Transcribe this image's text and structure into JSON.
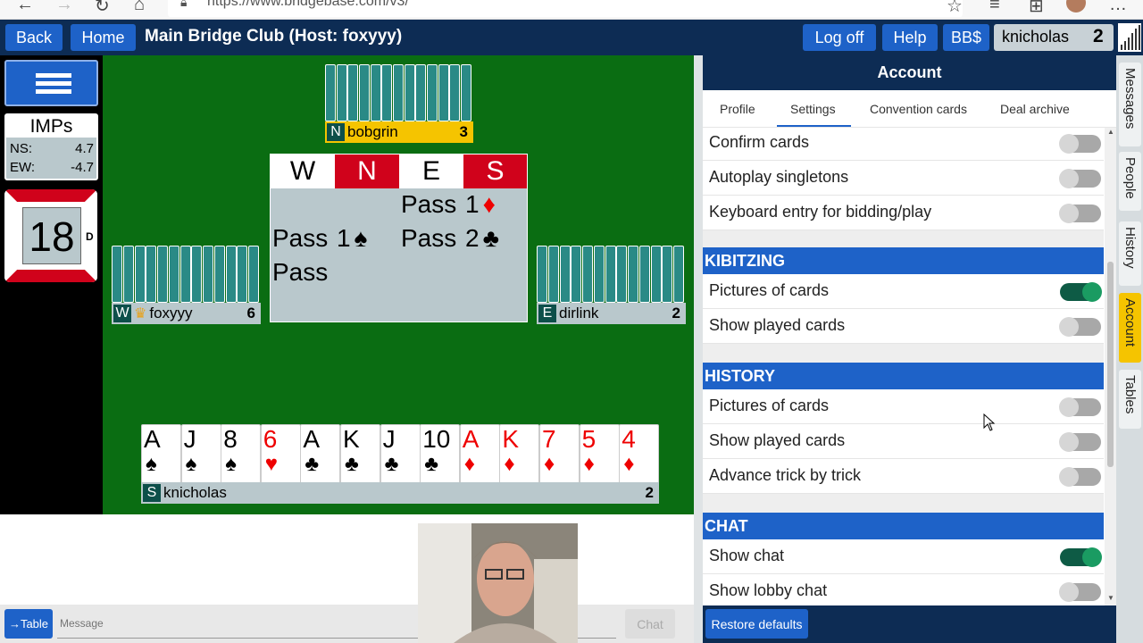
{
  "browser": {
    "url": "https://www.bridgebase.com/v3/"
  },
  "topbar": {
    "back": "Back",
    "home": "Home",
    "title": "Main Bridge Club (Host: foxyyy)",
    "logoff": "Log off",
    "help": "Help",
    "bbdollar": "BB$",
    "username": "knicholas",
    "count": "2"
  },
  "scoreboard": {
    "header": "IMPs",
    "ns_label": "NS:",
    "ns_value": "4.7",
    "ew_label": "EW:",
    "ew_value": "-4.7"
  },
  "board": {
    "number": "18",
    "dealer": "D"
  },
  "players": {
    "north": {
      "seat": "N",
      "name": "bobgrin",
      "count": "3"
    },
    "west": {
      "seat": "W",
      "name": "foxyyy",
      "count": "6"
    },
    "east": {
      "seat": "E",
      "name": "dirlink",
      "count": "2"
    },
    "south": {
      "seat": "S",
      "name": "knicholas",
      "count": "2"
    }
  },
  "auction": {
    "headers": [
      "W",
      "N",
      "E",
      "S"
    ],
    "bids": [
      {
        "text": "Pass",
        "col": 2,
        "row": 0,
        "suit": ""
      },
      {
        "text": "1",
        "col": 3,
        "row": 0,
        "suit": "♦"
      },
      {
        "text": "Pass",
        "col": 0,
        "row": 1,
        "suit": ""
      },
      {
        "text": "1",
        "col": 1,
        "row": 1,
        "suit": "♠"
      },
      {
        "text": "Pass",
        "col": 2,
        "row": 1,
        "suit": ""
      },
      {
        "text": "2",
        "col": 3,
        "row": 1,
        "suit": "♣"
      },
      {
        "text": "Pass",
        "col": 0,
        "row": 2,
        "suit": ""
      }
    ]
  },
  "hand": [
    {
      "rank": "A",
      "suit": "♠",
      "color": "black"
    },
    {
      "rank": "J",
      "suit": "♠",
      "color": "black"
    },
    {
      "rank": "8",
      "suit": "♠",
      "color": "black"
    },
    {
      "rank": "6",
      "suit": "♥",
      "color": "red"
    },
    {
      "rank": "A",
      "suit": "♣",
      "color": "black"
    },
    {
      "rank": "K",
      "suit": "♣",
      "color": "black"
    },
    {
      "rank": "J",
      "suit": "♣",
      "color": "black"
    },
    {
      "rank": "10",
      "suit": "♣",
      "color": "black"
    },
    {
      "rank": "A",
      "suit": "♦",
      "color": "red"
    },
    {
      "rank": "K",
      "suit": "♦",
      "color": "red"
    },
    {
      "rank": "7",
      "suit": "♦",
      "color": "red"
    },
    {
      "rank": "5",
      "suit": "♦",
      "color": "red"
    },
    {
      "rank": "4",
      "suit": "♦",
      "color": "red"
    }
  ],
  "chat": {
    "to_table": "→Table",
    "placeholder": "Message",
    "send": "Chat"
  },
  "account": {
    "title": "Account",
    "tabs": [
      "Profile",
      "Settings",
      "Convention cards",
      "Deal archive"
    ],
    "settings_rows": [
      "Confirm cards",
      "Autoplay singletons",
      "Keyboard entry for bidding/play"
    ],
    "kibitzing": {
      "header": "KIBITZING",
      "rows": [
        "Pictures of cards",
        "Show played cards"
      ]
    },
    "history": {
      "header": "HISTORY",
      "rows": [
        "Pictures of cards",
        "Show played cards",
        "Advance trick by trick"
      ]
    },
    "chat": {
      "header": "CHAT",
      "rows": [
        "Show chat",
        "Show lobby chat"
      ]
    },
    "restore": "Restore defaults"
  },
  "side_tabs": [
    "Messages",
    "People",
    "History",
    "Account",
    "Tables"
  ],
  "colors": {
    "navy": "#0d2c54",
    "blue": "#1e62c8",
    "felt": "#0a6d12",
    "toggle_on": "#1a9b62",
    "active_tab": "#f5c400"
  }
}
